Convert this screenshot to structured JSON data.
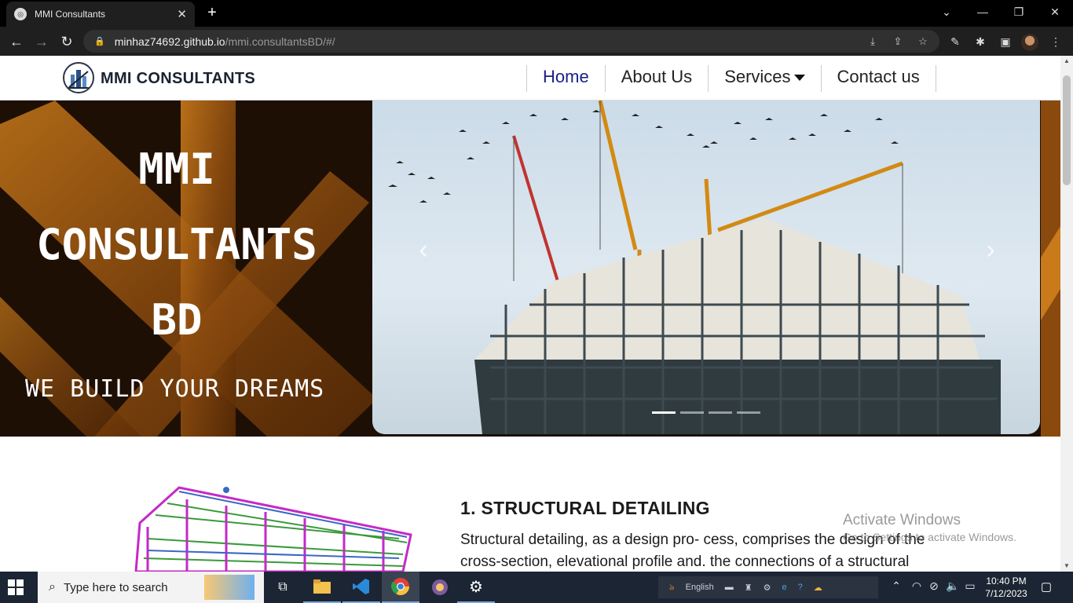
{
  "browser": {
    "tab_title": "MMI Consultants",
    "new_tab": "+",
    "close_tab": "✕",
    "url_host": "minhaz74692.github.io",
    "url_path": "/mmi.consultantsBD/#/"
  },
  "site": {
    "brand": "MMI CONSULTANTS",
    "menu": [
      {
        "label": "Home"
      },
      {
        "label": "About Us"
      },
      {
        "label": "Services"
      },
      {
        "label": "Contact us"
      }
    ],
    "hero": {
      "title_line1": "MMI",
      "title_line2": "CONSULTANTS",
      "title_line3": "BD",
      "tagline": "WE BUILD YOUR DREAMS"
    },
    "carousel": {
      "prev": "‹",
      "next": "›",
      "indicator_count": 4,
      "active_index": 0
    },
    "section": {
      "title": "1. STRUCTURAL DETAILING",
      "text": "Structural detailing, as a design pro- cess, comprises the design of the cross-section, elevational profile and. the connections of a structural"
    },
    "watermark": {
      "line1": "Activate Windows",
      "line2": "Go to Settings to activate Windows."
    }
  },
  "taskbar": {
    "search_placeholder": "Type here to search",
    "language": "English",
    "time": "10:40 PM",
    "date": "7/12/2023"
  }
}
